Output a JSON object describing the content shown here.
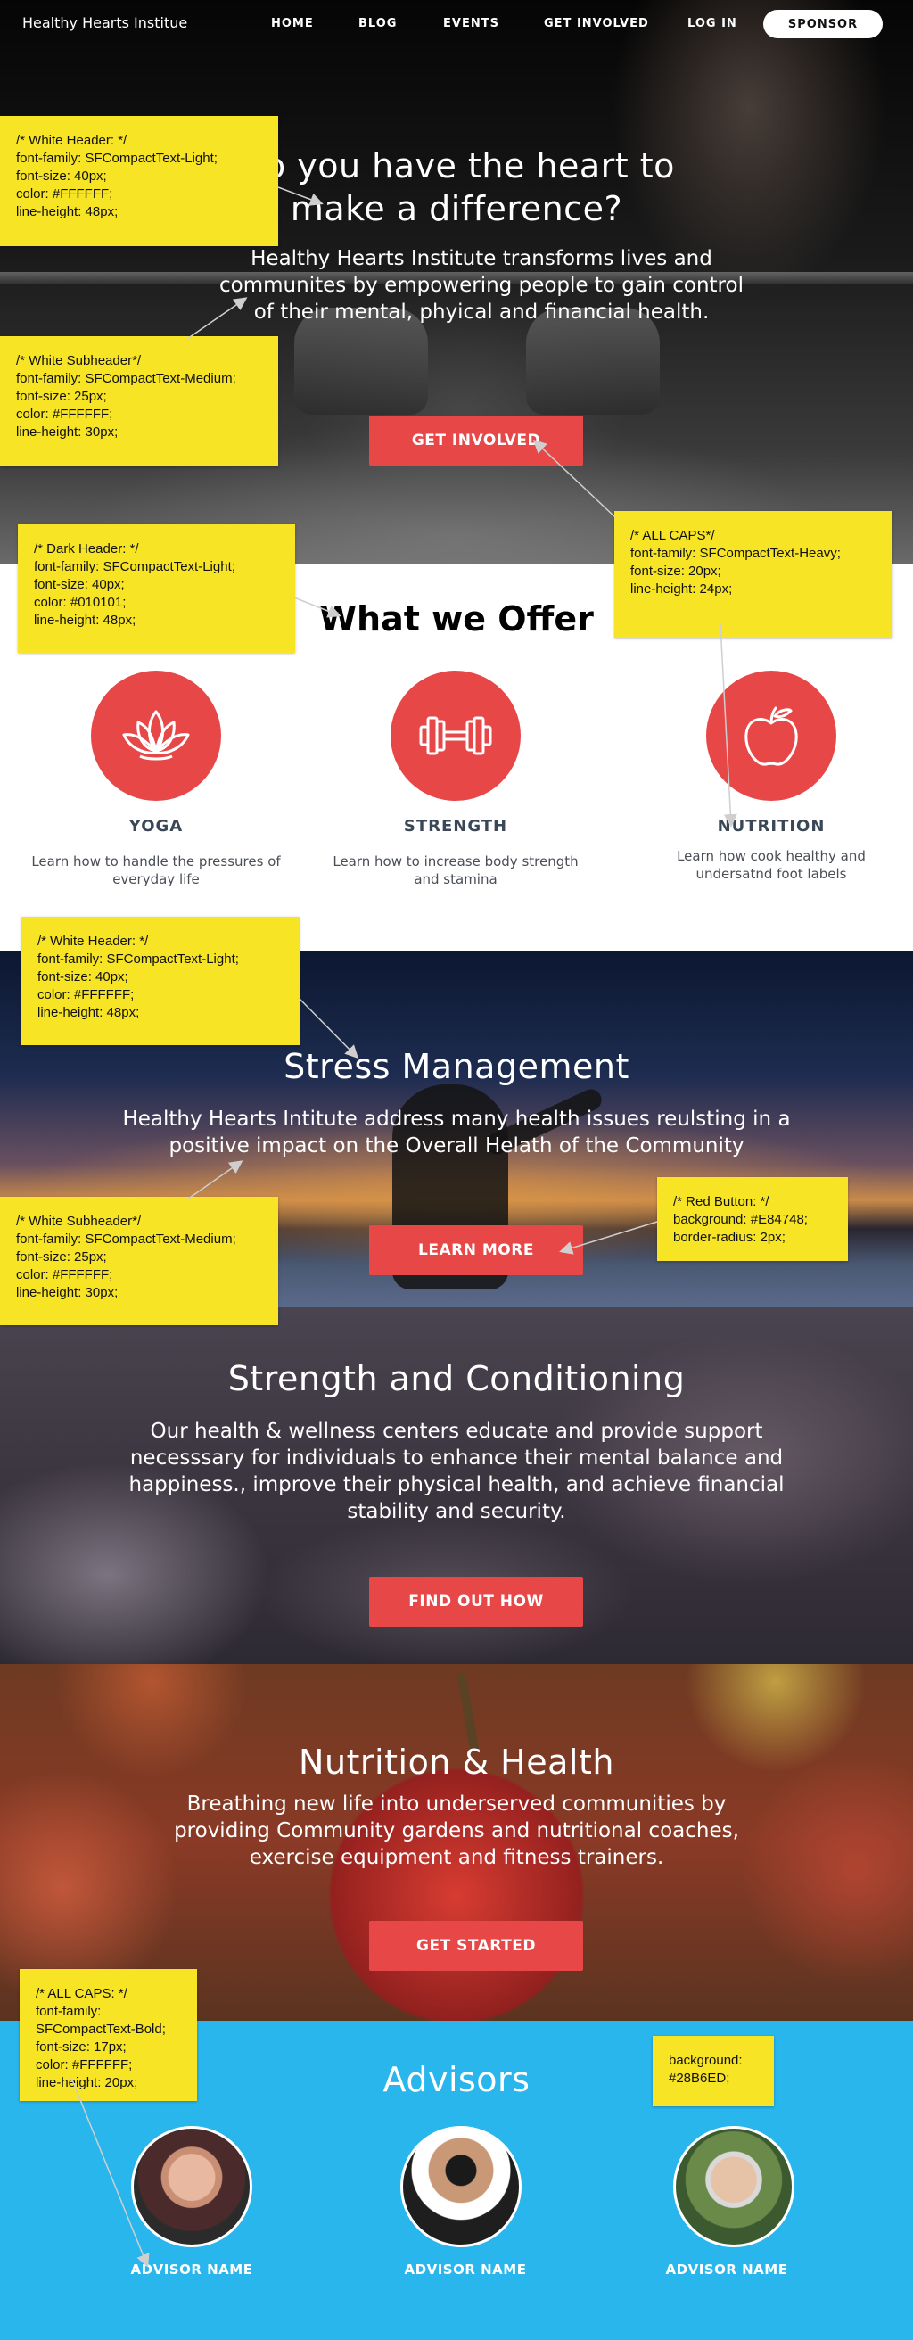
{
  "nav": {
    "brand": "Healthy Hearts Institue",
    "links": [
      "HOME",
      "BLOG",
      "EVENTS",
      "GET INVOLVED",
      "LOG IN"
    ],
    "sponsor": "SPONSOR"
  },
  "hero": {
    "title": "Do you have the heart to make a difference?",
    "subtitle": "Healthy Hearts Institute transforms lives and communites by empowering people to gain control of their mental, phyical and financial health.",
    "button": "GET INVOLVED"
  },
  "offer": {
    "title": "What we Offer",
    "items": [
      {
        "label": "YOGA",
        "desc": "Learn how to handle the pressures of everyday life",
        "icon": "lotus-icon"
      },
      {
        "label": "STRENGTH",
        "desc": "Learn how to increase body strength and stamina",
        "icon": "dumbbell-icon"
      },
      {
        "label": "NUTRITION",
        "desc": "Learn how cook healthy and undersatnd foot labels",
        "icon": "apple-icon"
      }
    ]
  },
  "stress": {
    "title": "Stress Management",
    "subtitle": "Healthy Hearts Intitute address many health issues reulsting in a positive impact on the Overall Helath of the Community",
    "button": "LEARN MORE"
  },
  "strength": {
    "title": "Strength and Conditioning",
    "subtitle": "Our health & wellness centers educate and provide support necesssary for individuals to enhance their mental balance and happiness., improve their physical health, and achieve financial stability and security.",
    "button": "FIND OUT HOW"
  },
  "nutrition": {
    "title": "Nutrition & Health",
    "subtitle": "Breathing new life into underserved communities by providing Community gardens and nutritional coaches, exercise equipment and fitness trainers.",
    "button": "GET STARTED"
  },
  "advisors": {
    "title": "Advisors",
    "names": [
      "ADVISOR NAME",
      "ADVISOR NAME",
      "ADVISOR NAME"
    ]
  },
  "notes": {
    "white_header_1": "/* White Header: */\nfont-family: SFCompactText-Light;\nfont-size: 40px;\ncolor: #FFFFFF;\nline-height: 48px;",
    "white_subheader_1": "/* White Subheader*/\nfont-family: SFCompactText-Medium;\nfont-size: 25px;\ncolor: #FFFFFF;\nline-height: 30px;",
    "dark_header": "/* Dark Header: */\nfont-family: SFCompactText-Light;\nfont-size: 40px;\ncolor: #010101;\nline-height: 48px;",
    "all_caps_heavy": "/* ALL CAPS*/\nfont-family: SFCompactText-Heavy;\nfont-size: 20px;\nline-height: 24px;",
    "white_header_2": "/* White Header: */\nfont-family: SFCompactText-Light;\nfont-size: 40px;\ncolor: #FFFFFF;\nline-height: 48px;",
    "white_subheader_2": "/* White Subheader*/\nfont-family: SFCompactText-Medium;\nfont-size: 25px;\ncolor: #FFFFFF;\nline-height: 30px;",
    "red_button": "/* Red Button: */\nbackground: #E84748;\nborder-radius: 2px;",
    "all_caps_bold": "/* ALL CAPS: */\nfont-family: SFCompactText-Bold;\nfont-size: 17px;\ncolor: #FFFFFF;\nline-height: 20px;",
    "advisors_bg": "background:\n#28B6ED;"
  },
  "colors": {
    "red": "#E84748",
    "blue": "#28B6ED",
    "note_yellow": "#F7E425"
  }
}
